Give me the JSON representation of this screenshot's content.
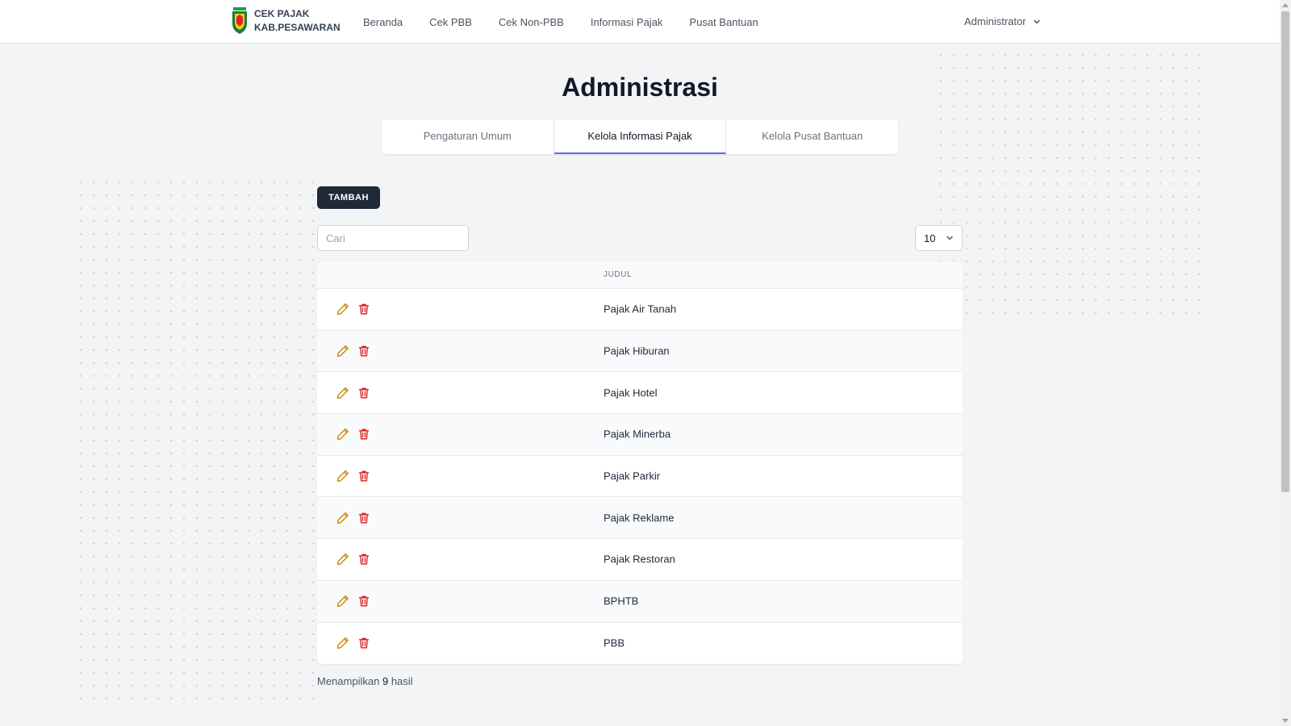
{
  "brand": {
    "line1": "CEK PAJAK",
    "line2": "KAB.PESAWARAN"
  },
  "nav": {
    "items": [
      {
        "label": "Beranda"
      },
      {
        "label": "Cek PBB"
      },
      {
        "label": "Cek Non-PBB"
      },
      {
        "label": "Informasi Pajak"
      },
      {
        "label": "Pusat Bantuan"
      }
    ],
    "user_label": "Administrator"
  },
  "page": {
    "title": "Administrasi"
  },
  "tabs": [
    {
      "label": "Pengaturan Umum",
      "active": false
    },
    {
      "label": "Kelola Informasi Pajak",
      "active": true
    },
    {
      "label": "Kelola Pusat Bantuan",
      "active": false
    }
  ],
  "toolbar": {
    "add_label": "TAMBAH",
    "search_placeholder": "Cari",
    "search_value": "",
    "per_page_value": "10"
  },
  "table": {
    "column_title": "JUDUL",
    "rows": [
      {
        "title": "Pajak Air Tanah"
      },
      {
        "title": "Pajak Hiburan"
      },
      {
        "title": "Pajak Hotel"
      },
      {
        "title": "Pajak Minerba"
      },
      {
        "title": "Pajak Parkir"
      },
      {
        "title": "Pajak Reklame"
      },
      {
        "title": "Pajak Restoran"
      },
      {
        "title": "BPHTB"
      },
      {
        "title": "PBB"
      }
    ]
  },
  "footer": {
    "result_prefix": "Menampilkan",
    "result_count": "9",
    "result_suffix": "hasil"
  },
  "colors": {
    "accent_tab": "#6366f1",
    "edit_icon": "#ca8a04",
    "delete_icon": "#dc2626",
    "primary_button": "#1f2937"
  },
  "icons": {
    "edit": "pencil-icon",
    "delete": "trash-icon",
    "user_menu": "chevron-down-icon",
    "per_page": "chevron-down-icon",
    "logo": "shield-logo"
  }
}
